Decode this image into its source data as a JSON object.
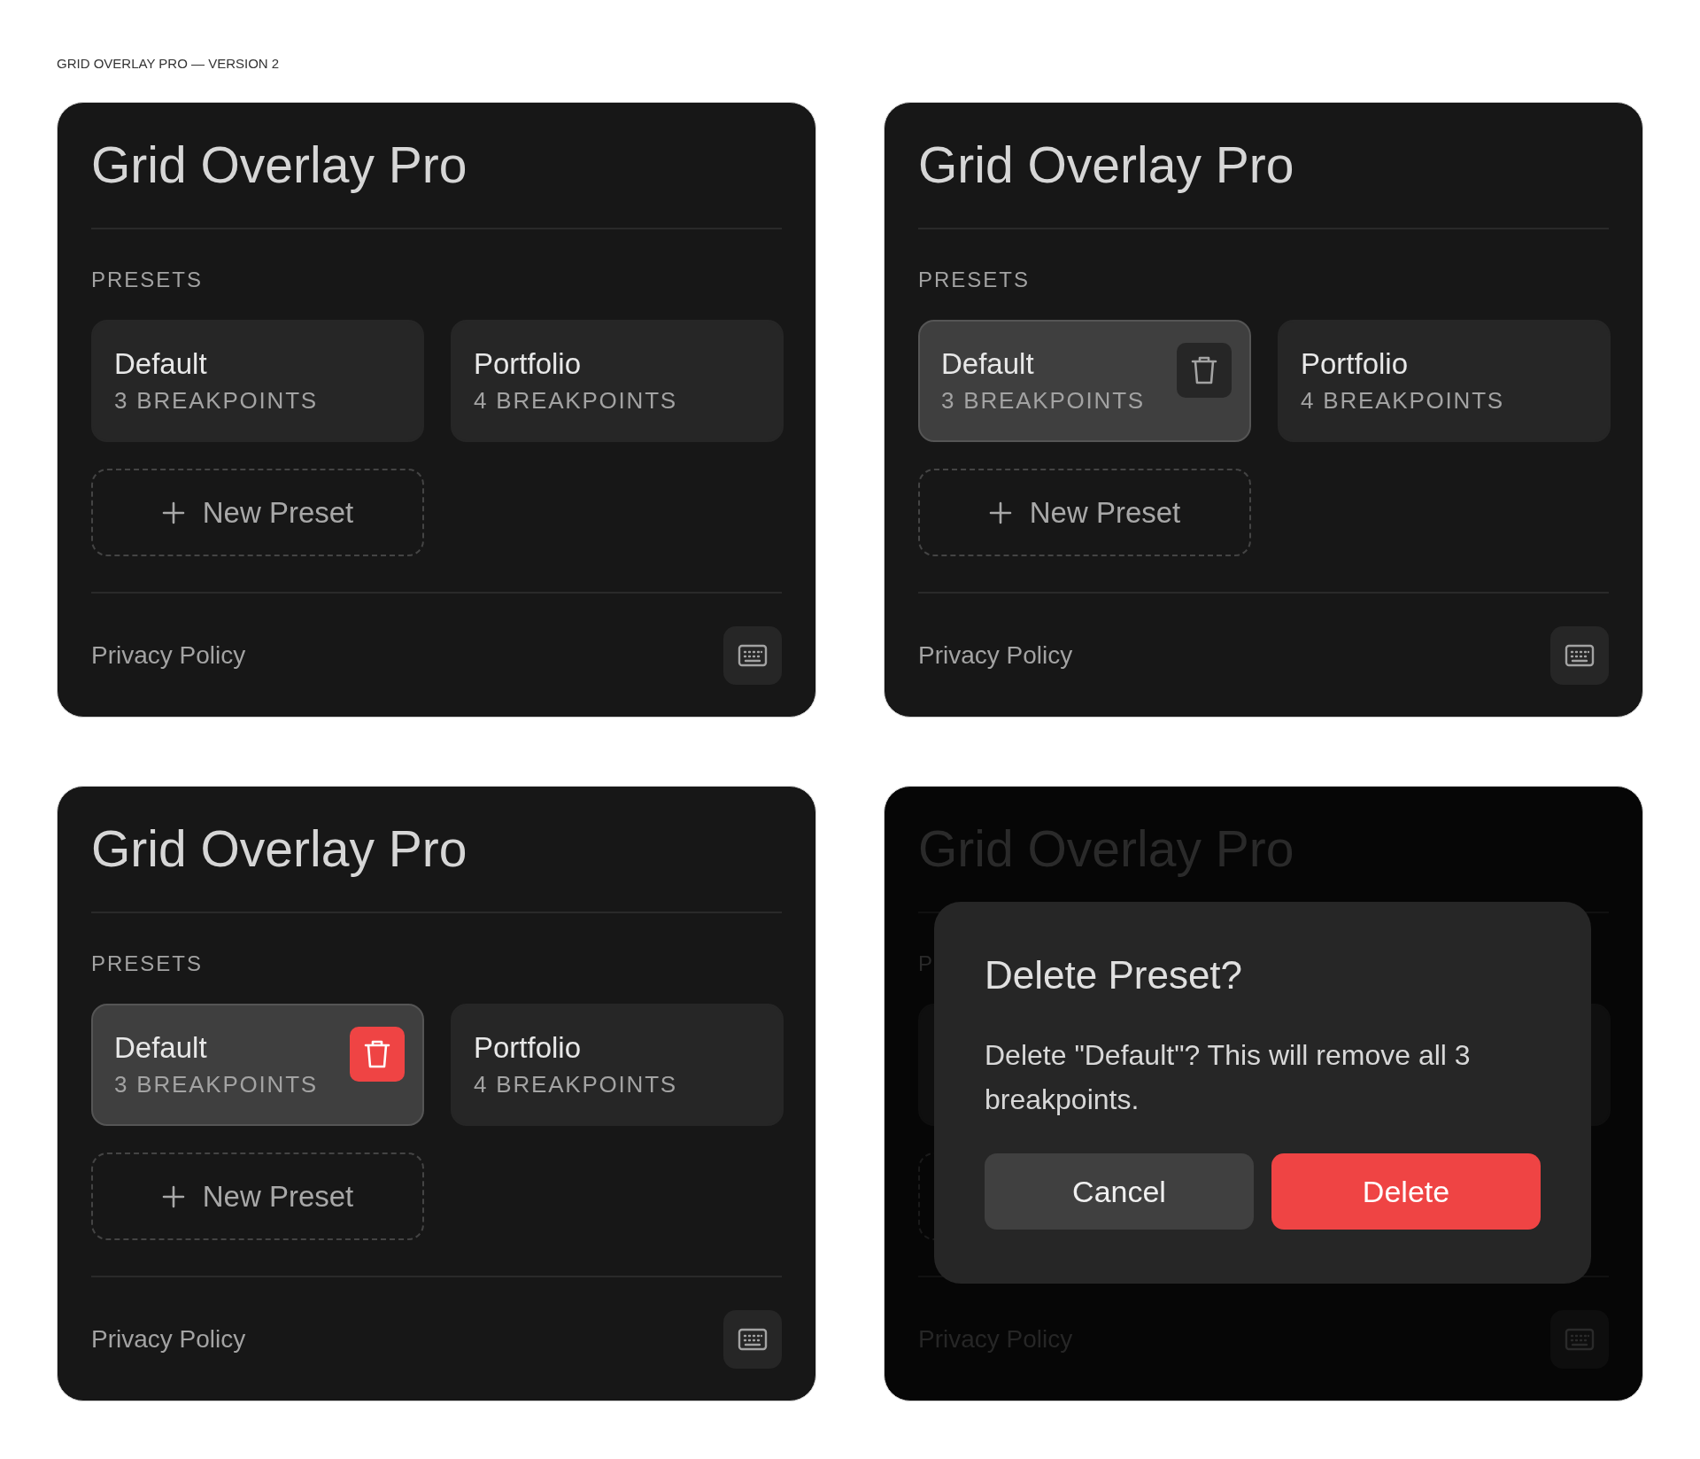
{
  "page_title": "GRID OVERLAY PRO — VERSION 2",
  "panels": [
    {
      "kind": "list",
      "title": "Grid Overlay Pro",
      "section_label": "PRESETS",
      "presets": [
        {
          "name": "Default",
          "count": "3 BREAKPOINTS",
          "selected": false
        },
        {
          "name": "Portfolio",
          "count": "4 BREAKPOINTS",
          "selected": false
        }
      ],
      "new_preset": "New Preset",
      "footer_link": "Privacy Policy"
    },
    {
      "kind": "list",
      "title": "Grid Overlay Pro",
      "section_label": "PRESETS",
      "presets": [
        {
          "name": "Default",
          "count": "3 BREAKPOINTS",
          "selected": true,
          "delete_highlighted": false
        },
        {
          "name": "Portfolio",
          "count": "4 BREAKPOINTS",
          "selected": false
        }
      ],
      "new_preset": "New Preset",
      "footer_link": "Privacy Policy"
    },
    {
      "kind": "list",
      "title": "Grid Overlay Pro",
      "section_label": "PRESETS",
      "presets": [
        {
          "name": "Default",
          "count": "3 BREAKPOINTS",
          "selected": true,
          "delete_highlighted": true
        },
        {
          "name": "Portfolio",
          "count": "4 BREAKPOINTS",
          "selected": false
        }
      ],
      "new_preset": "New Preset",
      "footer_link": "Privacy Policy"
    },
    {
      "kind": "dialog",
      "title": "Grid Overlay Pro",
      "section_label": "P",
      "footer_link": "Privacy Policy",
      "dialog": {
        "title": "Delete Preset?",
        "message": "Delete \"Default\"? This will remove all 3 breakpoints.",
        "buttons": [
          {
            "label": "Cancel",
            "kind": "secondary"
          },
          {
            "label": "Delete",
            "kind": "danger"
          }
        ]
      }
    }
  ]
}
